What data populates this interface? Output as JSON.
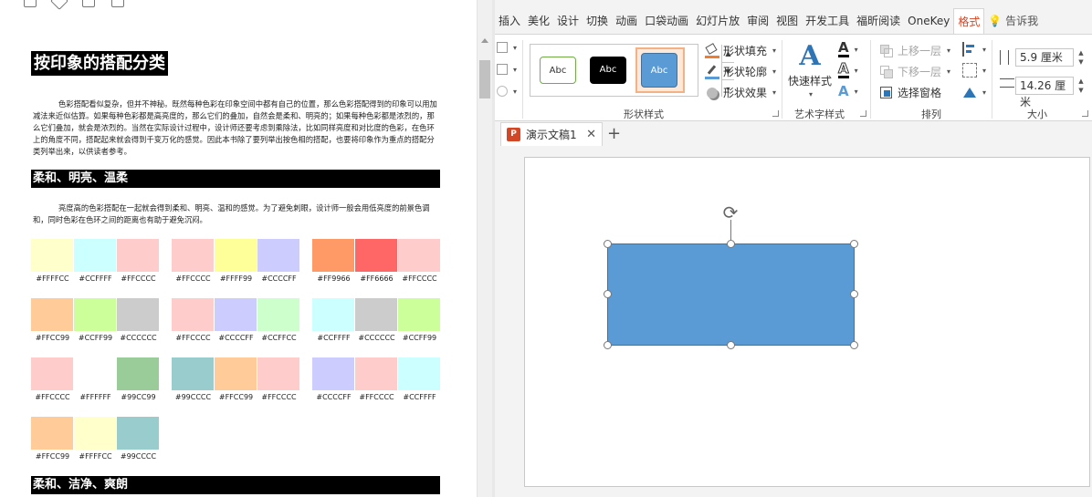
{
  "doc": {
    "title": "按印象的搭配分类",
    "intro": "色彩搭配看似复杂，但并不神秘。既然每种色彩在印象空间中都有自己的位置，那么色彩搭配得到的印象可以用加减法来近似估算。如果每种色彩都是高亮度的，那么它们的叠加，自然会是柔和、明亮的；如果每种色彩都是浓烈的，那么它们叠加，就会是浓烈的。当然在实际设计过程中，设计师还要考虑到乘除法，比如同样亮度和对比度的色彩，在色环上的角度不同，搭配起来就会得到千变万化的感觉。因此本书除了要列举出按色相的搭配，也要将印象作为重点的搭配分类列举出来，以供读者参考。",
    "section1": "柔和、明亮、温柔",
    "section1_text": "亮度高的色彩搭配在一起就会得到柔和、明亮、温和的感觉。为了避免刺眼，设计师一般会用低亮度的前景色调和，同时色彩在色环之间的距离也有助于避免沉闷。",
    "section2": "柔和、洁净、爽朗",
    "swatch_groups": [
      [
        "#FFFFCC",
        "#CCFFFF",
        "#FFCCCC"
      ],
      [
        "#FFCCCC",
        "#FFFF99",
        "#CCCCFF"
      ],
      [
        "#FF9966",
        "#FF6666",
        "#FFCCCC"
      ],
      [
        "#FFCC99",
        "#CCFF99",
        "#CCCCCC"
      ],
      [
        "#FFCCCC",
        "#CCCCFF",
        "#CCFFCC"
      ],
      [
        "#CCFFFF",
        "#CCCCCC",
        "#CCFF99"
      ],
      [
        "#FFCCCC",
        "#FFFFFF",
        "#99CC99"
      ],
      [
        "#99CCCC",
        "#FFCC99",
        "#FFCCCC"
      ],
      [
        "#CCCCFF",
        "#FFCCCC",
        "#CCFFFF"
      ],
      [
        "#FFCC99",
        "#FFFFCC",
        "#99CCCC"
      ]
    ]
  },
  "ribbon": {
    "tabs": [
      "插入",
      "美化",
      "设计",
      "切换",
      "动画",
      "口袋动画",
      "幻灯片放",
      "审阅",
      "视图",
      "开发工具",
      "福昕阅读",
      "OneKey",
      "格式"
    ],
    "active_tab": "格式",
    "tell_me": "告诉我",
    "shape_styles": {
      "thumb_label": "Abc",
      "fill": "形状填充",
      "outline": "形状轮廓",
      "effect": "形状效果",
      "group_label": "形状样式"
    },
    "wordart": {
      "quick_styles": "快速样式",
      "group_label": "艺术字样式"
    },
    "arrange": {
      "bring_forward": "上移一层",
      "send_backward": "下移一层",
      "selection_pane": "选择窗格",
      "group_label": "排列"
    },
    "size": {
      "height": "5.9 厘米",
      "width": "14.26 厘米",
      "group_label": "大小"
    }
  },
  "document_tab": {
    "title": "演示文稿1",
    "badge": "P"
  },
  "colors": {
    "accent": "#d24726",
    "shape_fill": "#5b9bd5",
    "shape_outline": "#41719c"
  }
}
